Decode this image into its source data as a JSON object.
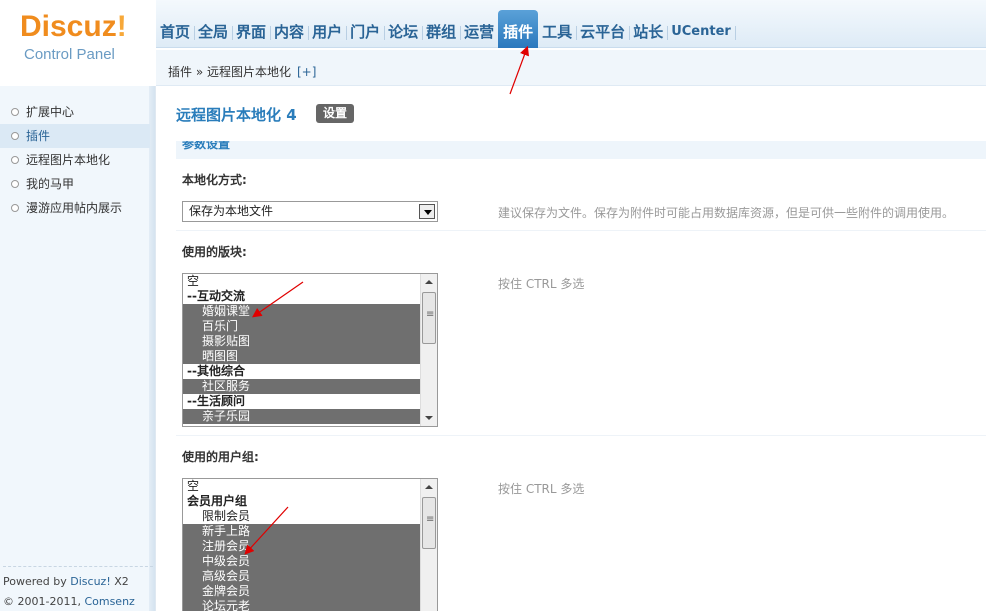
{
  "logo": {
    "brand": "Discuz",
    "bang": "!",
    "sub": "Control Panel"
  },
  "topnav": {
    "items": [
      "首页",
      "全局",
      "界面",
      "内容",
      "用户",
      "门户",
      "论坛",
      "群组",
      "运营",
      "插件",
      "工具",
      "云平台",
      "站长",
      "UCenter"
    ],
    "active": "插件"
  },
  "breadcrumb": {
    "path": "插件 » 远程图片本地化",
    "add": "[+]"
  },
  "sidebar": {
    "items": [
      "扩展中心",
      "插件",
      "远程图片本地化",
      "我的马甲",
      "漫游应用帖内展示"
    ],
    "active_index": 1,
    "footer": {
      "powered_prefix": "Powered by ",
      "powered_link": "Discuz!",
      "powered_version": " X2",
      "copyright_prefix": "© 2001-2011, ",
      "copyright_link": "Comsenz Inc."
    }
  },
  "main": {
    "title": "远程图片本地化 4",
    "setting_button": "设置",
    "section_heading": "参数设置",
    "method": {
      "label": "本地化方式:",
      "value": "保存为本地文件",
      "hint": "建议保存为文件。保存为附件时可能占用数据库资源，但是可供一些附件的调用使用。"
    },
    "forums": {
      "label": "使用的版块:",
      "hint": "按住 CTRL 多选",
      "options": [
        "空",
        "--互动交流",
        "婚姻课堂",
        "百乐门",
        "摄影贴图",
        "晒图图",
        "--其他综合",
        "社区服务",
        "--生活顾问",
        "亲子乐园"
      ]
    },
    "groups": {
      "label": "使用的用户组:",
      "hint": "按住 CTRL 多选",
      "options": [
        "空",
        "会员用户组",
        "限制会员",
        "新手上路",
        "注册会员",
        "中级会员",
        "高级会员",
        "金牌会员",
        "论坛元老"
      ]
    }
  },
  "colors": {
    "accent": "#2a7dbb",
    "selected_bg": "#6f6f6f",
    "arrow": "#e00000",
    "logo_orange": "#f08c1e"
  }
}
